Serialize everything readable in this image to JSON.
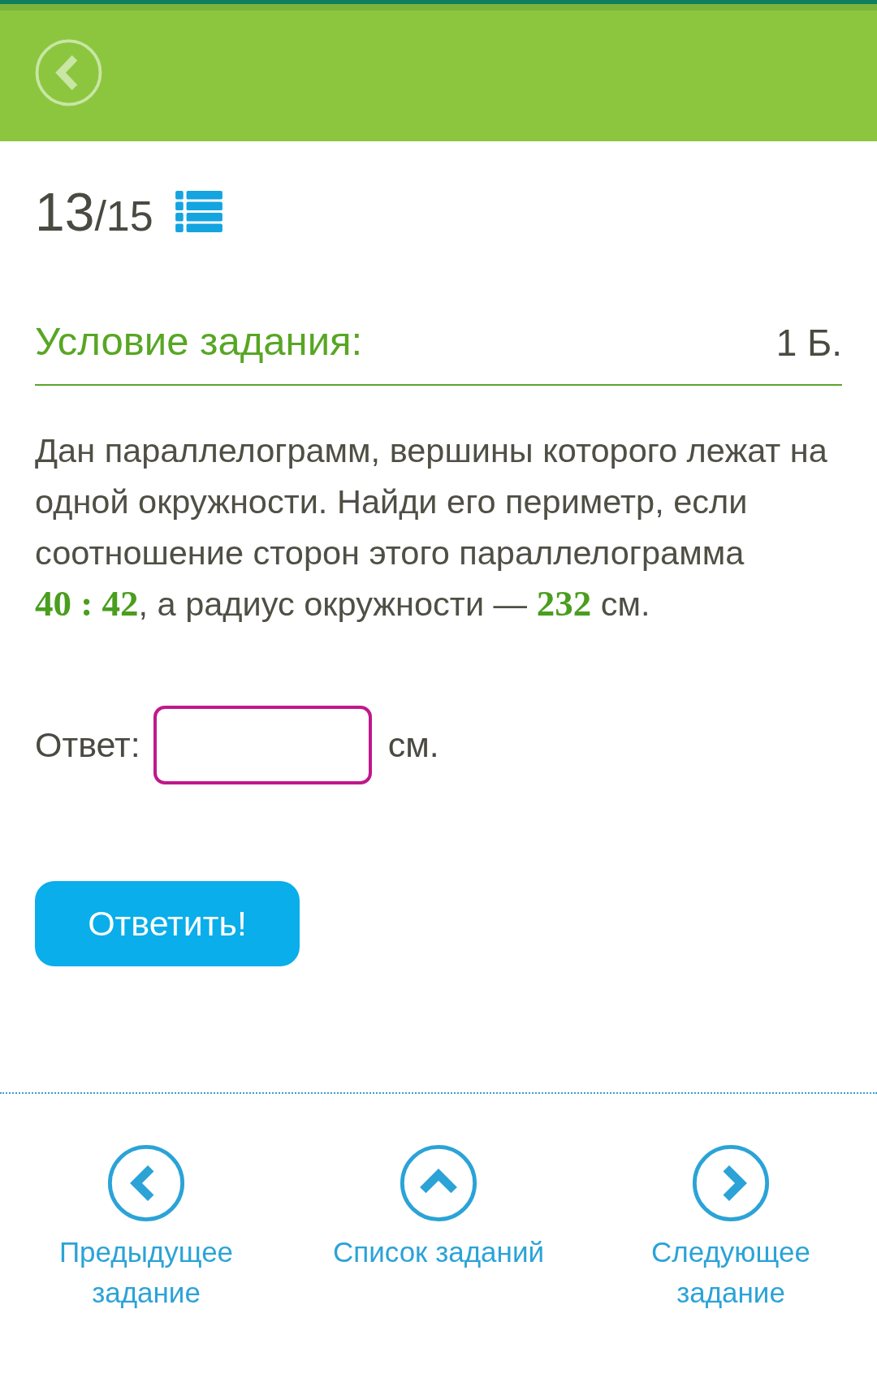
{
  "counter": {
    "current": "13",
    "total": "/15"
  },
  "task": {
    "title": "Условие задания:",
    "points": "1 Б.",
    "text": "Дан параллелограмм, вершины которого лежат на одной окружности. Найди его периметр, если соотношение сторон этого параллелограмма **40 : 42**, а радиус окружности — **232** см."
  },
  "answer": {
    "label": "Ответ:",
    "unit": "см.",
    "submit": "Ответить!"
  },
  "navigation": [
    {
      "kind": "previous",
      "label": "Предыдущее задание"
    },
    {
      "kind": "list",
      "label": "Список заданий"
    },
    {
      "kind": "next",
      "label": "Следующее задание"
    }
  ]
}
